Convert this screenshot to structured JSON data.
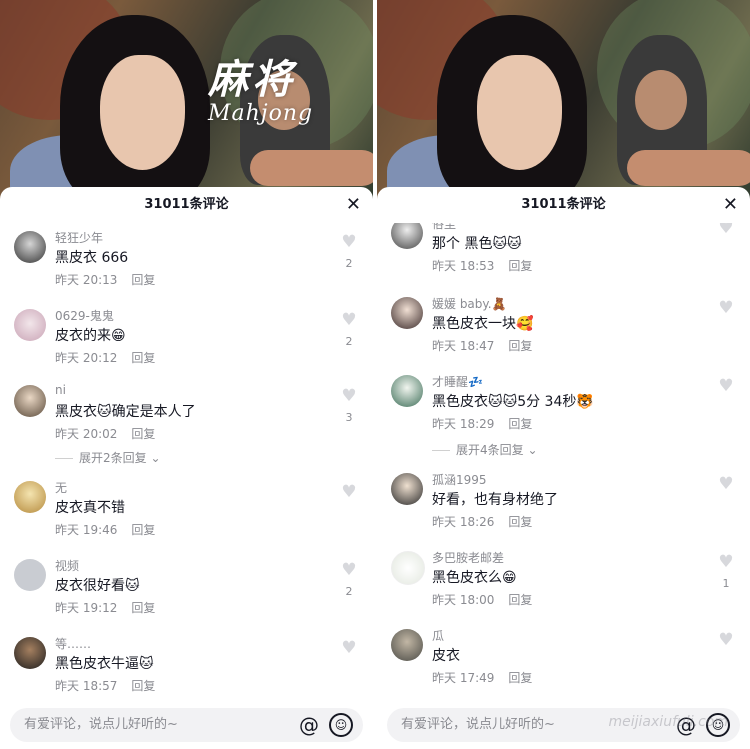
{
  "left": {
    "header": {
      "count": "31011条评论",
      "close": "✕"
    },
    "title_art": {
      "cn": "麻将",
      "en": "Mahjong"
    },
    "comments": [
      {
        "user": "轻狂少年",
        "text": "黑皮衣 666",
        "time": "昨天 20:13",
        "reply": "回复",
        "likes": "2"
      },
      {
        "user": "0629-鬼鬼",
        "text": "皮衣的来😁",
        "time": "昨天 20:12",
        "reply": "回复",
        "likes": "2"
      },
      {
        "user": "ni",
        "text": "黑皮衣🐱确定是本人了",
        "time": "昨天 20:02",
        "reply": "回复",
        "likes": "3",
        "expand": "展开2条回复"
      },
      {
        "user": "无",
        "text": "皮衣真不错",
        "time": "昨天 19:46",
        "reply": "回复",
        "likes": ""
      },
      {
        "user": "视频",
        "text": "皮衣很好看🐱",
        "time": "昨天 19:12",
        "reply": "回复",
        "likes": "2"
      },
      {
        "user": "等……",
        "text": "黑色皮衣牛逼🐱",
        "time": "昨天 18:57",
        "reply": "回复",
        "likes": ""
      }
    ],
    "input_placeholder": "有爱评论，说点儿好听的~"
  },
  "right": {
    "header": {
      "count": "31011条评论",
      "close": "✕"
    },
    "comments": [
      {
        "user": "俗尘",
        "text": "那个 黑色🐱🐱",
        "time": "昨天 18:53",
        "reply": "回复",
        "likes": ""
      },
      {
        "user": "媛媛 baby.🧸",
        "text": "黑色皮衣一块🥰",
        "time": "昨天 18:47",
        "reply": "回复",
        "likes": ""
      },
      {
        "user": "才睡醒💤",
        "text": "黑色皮衣🐱🐱5分 34秒🐯",
        "time": "昨天 18:29",
        "reply": "回复",
        "likes": "",
        "expand": "展开4条回复"
      },
      {
        "user": "孤涵1995",
        "text": "好看，也有身材绝了",
        "time": "昨天 18:26",
        "reply": "回复",
        "likes": ""
      },
      {
        "user": "多巴胺老邮差",
        "text": "黑色皮衣么😁",
        "time": "昨天 18:00",
        "reply": "回复",
        "likes": "1"
      },
      {
        "user": "瓜",
        "text": "皮衣",
        "time": "昨天 17:49",
        "reply": "回复",
        "likes": ""
      }
    ],
    "input_placeholder": "有爱评论，说点儿好听的~",
    "watermark": "meijiaxiufuli.com"
  },
  "icons": {
    "heart": "♥",
    "at": "@",
    "smile": "☺",
    "chevron": "⌄"
  }
}
